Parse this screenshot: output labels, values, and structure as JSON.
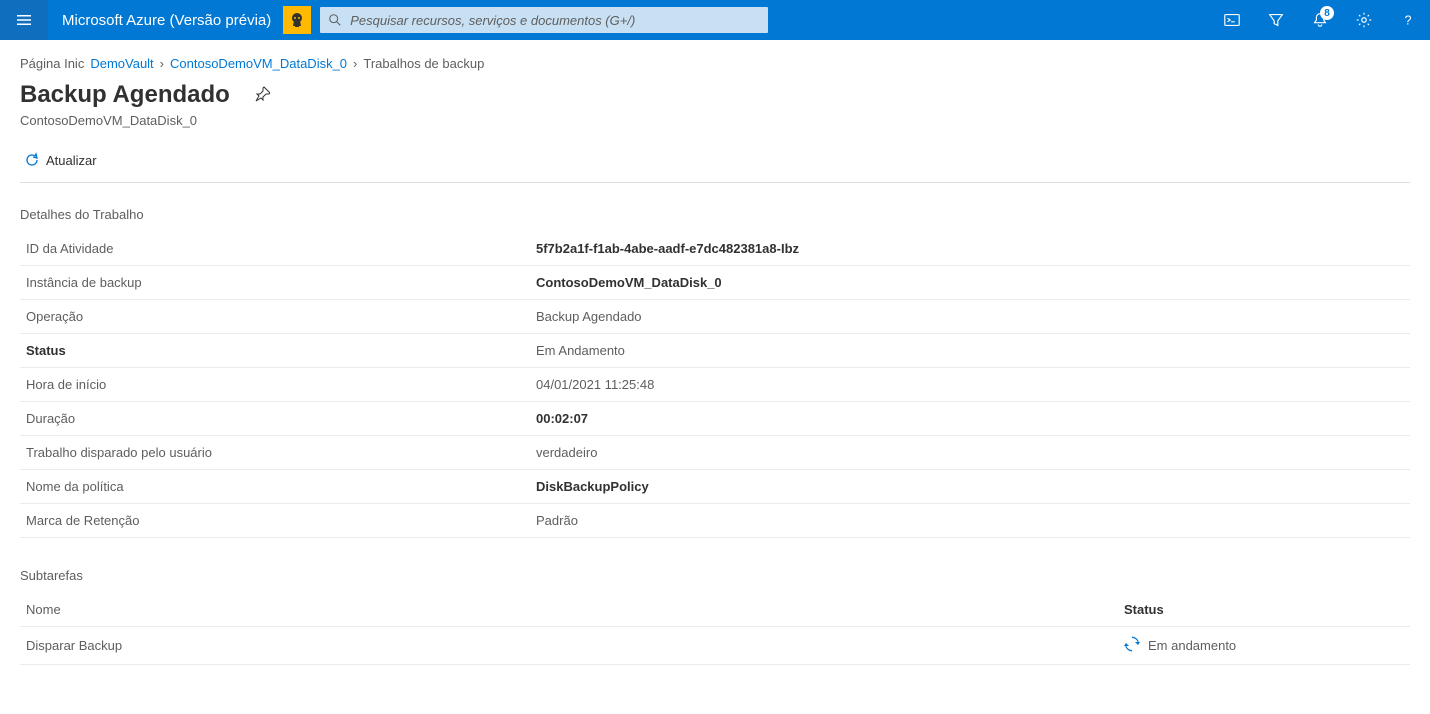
{
  "topbar": {
    "brand": "Microsoft Azure (Versão prévia)",
    "search_placeholder": "Pesquisar recursos, serviços e documentos (G+/)",
    "notification_count": "8"
  },
  "breadcrumb": {
    "home": "Página Inic",
    "vault": "DemoVault",
    "instance": "ContosoDemoVM_DataDisk_0",
    "current": "Trabalhos de backup"
  },
  "page": {
    "title": "Backup Agendado",
    "subtitle": "ContosoDemoVM_DataDisk_0"
  },
  "toolbar": {
    "refresh_label": "Atualizar"
  },
  "details": {
    "heading": "Detalhes do Trabalho",
    "rows": [
      {
        "label": "ID da Atividade",
        "value": "5f7b2a1f-f1ab-4abe-aadf-e7dc482381a8-Ibz",
        "bold_value": true
      },
      {
        "label": "Instância de backup",
        "value": "ContosoDemoVM_DataDisk_0",
        "bold_value": true
      },
      {
        "label": "Operação",
        "value": "Backup Agendado",
        "bold_value": false
      },
      {
        "label": "Status",
        "value": "Em Andamento",
        "bold_label": true
      },
      {
        "label": "Hora de início",
        "value": "04/01/2021 11:25:48"
      },
      {
        "label": "Duração",
        "value": "00:02:07",
        "bold_value": true
      },
      {
        "label": "Trabalho disparado pelo usuário",
        "value": "verdadeiro"
      },
      {
        "label": "Nome da política",
        "value": "DiskBackupPolicy",
        "bold_value": true
      },
      {
        "label": "Marca de Retenção",
        "value": "Padrão"
      }
    ]
  },
  "subtasks": {
    "heading": "Subtarefas",
    "col_name": "Nome",
    "col_status": "Status",
    "rows": [
      {
        "name": "Disparar Backup",
        "status": "Em andamento"
      }
    ]
  }
}
